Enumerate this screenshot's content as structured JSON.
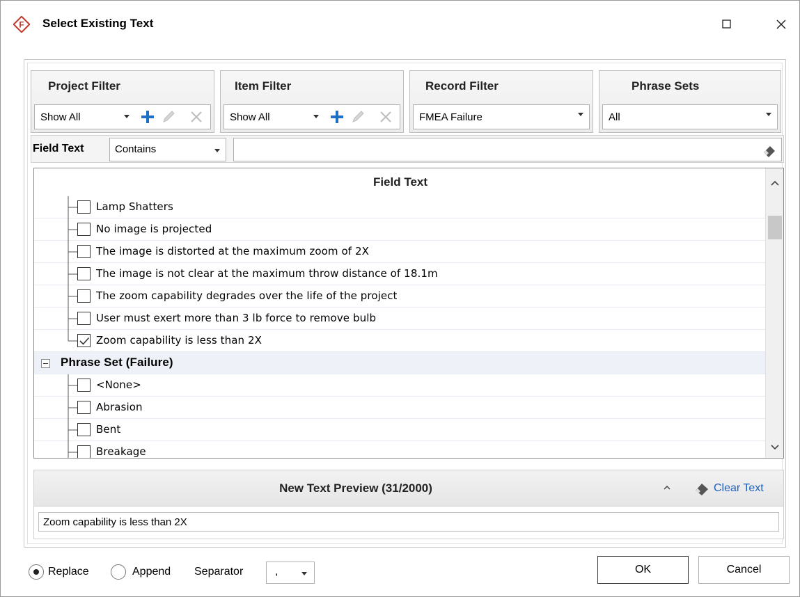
{
  "window": {
    "title": "Select Existing Text"
  },
  "filters": {
    "project": {
      "title": "Project Filter",
      "value": "Show All"
    },
    "item": {
      "title": "Item Filter",
      "value": "Show All"
    },
    "record": {
      "title": "Record Filter",
      "value": "FMEA Failure"
    },
    "phrase": {
      "title": "Phrase Sets",
      "value": "All"
    }
  },
  "field_text": {
    "label": "Field Text",
    "mode": "Contains",
    "search_value": ""
  },
  "tree": {
    "header": "Field Text",
    "items": [
      {
        "label": "Lamp Shatters",
        "checked": false
      },
      {
        "label": "No image is projected",
        "checked": false
      },
      {
        "label": "The image is distorted at the maximum zoom of 2X",
        "checked": false
      },
      {
        "label": "The image is not clear at the maximum throw distance of 18.1m",
        "checked": false
      },
      {
        "label": "The zoom capability degrades over the life of the project",
        "checked": false
      },
      {
        "label": "User must exert more than 3 lb force to remove bulb",
        "checked": false
      },
      {
        "label": "Zoom capability is less than 2X",
        "checked": true
      }
    ],
    "group": {
      "label": "Phrase Set (Failure)"
    },
    "group_items": [
      {
        "label": "<None>",
        "checked": false
      },
      {
        "label": "Abrasion",
        "checked": false
      },
      {
        "label": "Bent",
        "checked": false
      },
      {
        "label": "Breakage",
        "checked": false
      }
    ]
  },
  "preview": {
    "title": "New Text Preview (31/2000)",
    "clear_label": "Clear Text",
    "text": "Zoom capability is less than 2X"
  },
  "bottom": {
    "replace_label": "Replace",
    "append_label": "Append",
    "separator_label": "Separator",
    "separator_value": ",",
    "mode_selected": "Replace",
    "ok_label": "OK",
    "cancel_label": "Cancel"
  },
  "colors": {
    "accent_blue": "#1f6fc5",
    "logo_red": "#c0392b"
  }
}
